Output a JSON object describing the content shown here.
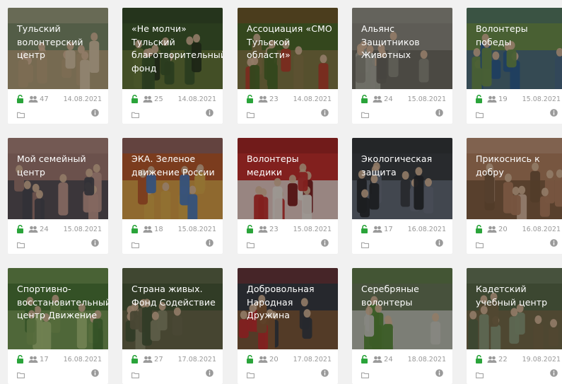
{
  "cards": [
    {
      "title": "Тульский волонтерский центр",
      "members": "47",
      "date": "14.08.2021",
      "image": "group-photo-outdoor",
      "colors": [
        "#7d8b6a",
        "#b9a27c",
        "#d7c4a6"
      ]
    },
    {
      "title": "«Не молчи» Тульский благотворительный фонд",
      "members": "25",
      "date": "14.08.2021",
      "image": "people-in-park",
      "colors": [
        "#3f5a2e",
        "#6b7d3c",
        "#2c3a22"
      ]
    },
    {
      "title": "Ассоциация «СМО Тульской области»",
      "members": "23",
      "date": "14.08.2021",
      "image": "children-playground",
      "colors": [
        "#4e6a2c",
        "#8a7a4a",
        "#b5402e"
      ]
    },
    {
      "title": "Альянс Защитников Животных",
      "members": "24",
      "date": "15.08.2021",
      "image": "cat",
      "colors": [
        "#8c8a80",
        "#6b6860",
        "#a8a69c"
      ]
    },
    {
      "title": "Волонтеры победы",
      "members": "19",
      "date": "15.08.2021",
      "image": "volunteers-lineup",
      "colors": [
        "#6e8f4d",
        "#4b6a86",
        "#2f5d8f"
      ]
    },
    {
      "title": "Мой семейный центр",
      "members": "24",
      "date": "15.08.2021",
      "image": "families-indoor",
      "colors": [
        "#a07a72",
        "#4b4a52",
        "#c39a8e"
      ]
    },
    {
      "title": "ЭКА. Зеленое движение России",
      "members": "18",
      "date": "15.08.2021",
      "image": "bottle-caps",
      "colors": [
        "#b85a2e",
        "#d9a94a",
        "#4f7ab8"
      ]
    },
    {
      "title": "Волонтеры медики",
      "members": "23",
      "date": "15.08.2021",
      "image": "medics-in-red",
      "colors": [
        "#c2302d",
        "#e9e2da",
        "#7a1e1e"
      ]
    },
    {
      "title": "Экологическая защита",
      "members": "17",
      "date": "16.08.2021",
      "image": "people-with-trash",
      "colors": [
        "#3c3f44",
        "#6a7280",
        "#2b2d31"
      ]
    },
    {
      "title": "Прикоснись к добру",
      "members": "20",
      "date": "16.08.2021",
      "image": "kids-craft",
      "colors": [
        "#b28060",
        "#7a5a3e",
        "#d8b8a0"
      ]
    },
    {
      "title": "Спортивно-восстановительный центр Движение",
      "members": "17",
      "date": "16.08.2021",
      "image": "park-exercise",
      "colors": [
        "#4e7a3a",
        "#7fa05a",
        "#a8c07a"
      ]
    },
    {
      "title": "Страна живых. Фонд Содействие",
      "members": "27",
      "date": "17.08.2021",
      "image": "forest-group",
      "colors": [
        "#4a5a3a",
        "#6e6a4e",
        "#8a8a6a"
      ]
    },
    {
      "title": "Добровольная Народная Дружина",
      "members": "20",
      "date": "17.08.2021",
      "image": "church-guards",
      "colors": [
        "#3a3d44",
        "#8a5e3a",
        "#c23030"
      ]
    },
    {
      "title": "Серебряные волонтеры",
      "members": "24",
      "date": "18.08.2021",
      "image": "meeting-table",
      "colors": [
        "#6a7a5a",
        "#c8c8c0",
        "#5a8a3a"
      ]
    },
    {
      "title": "Кадетский учебный центр",
      "members": "22",
      "date": "19.08.2021",
      "image": "cadets-outdoor",
      "colors": [
        "#5a6a4a",
        "#7a6a4a",
        "#8a9a7a"
      ]
    }
  ],
  "icons": {
    "lock": "lock-open-icon",
    "users": "users-icon",
    "folder": "folder-icon",
    "info": "info-icon"
  },
  "accent": "#2aa43a"
}
